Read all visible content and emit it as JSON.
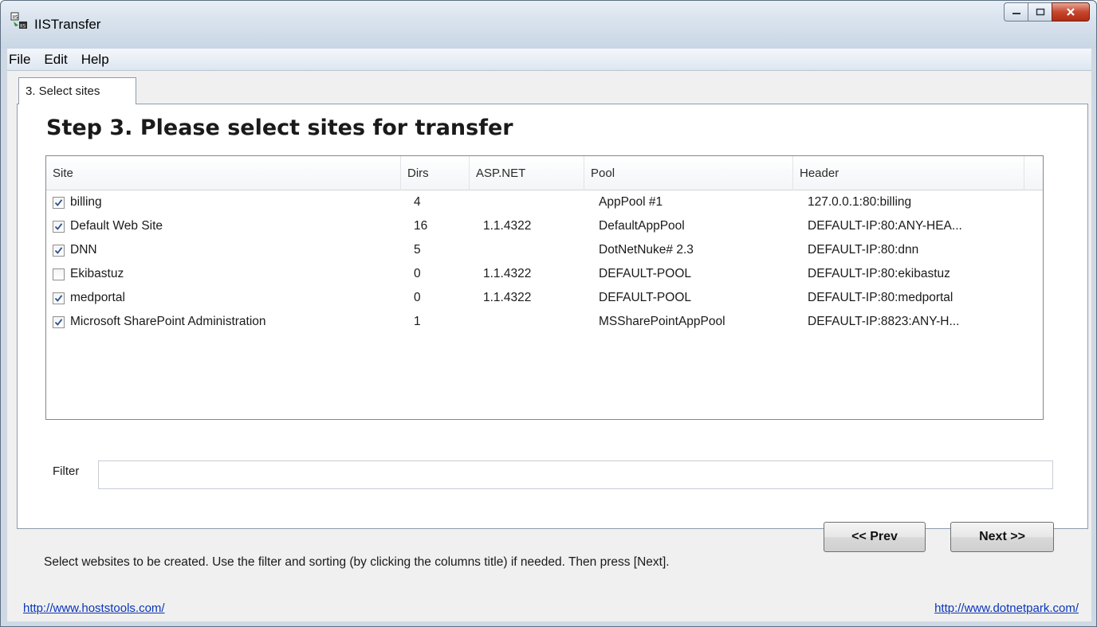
{
  "window": {
    "title": "IISTransfer",
    "icon": "app-icon",
    "controls": {
      "minimize": "minimize-icon",
      "maximize": "maximize-icon",
      "close": "close-icon"
    }
  },
  "menu": {
    "items": [
      "File",
      "Edit",
      "Help"
    ]
  },
  "tab": {
    "label": "3. Select sites"
  },
  "page": {
    "title": "Step 3. Please select sites for transfer"
  },
  "table": {
    "columns": [
      "Site",
      "Dirs",
      "ASP.NET",
      "Pool",
      "Header"
    ],
    "rows": [
      {
        "checked": true,
        "site": "billing",
        "dirs": "4",
        "aspnet": "",
        "pool": "AppPool #1",
        "header": "127.0.0.1:80:billing"
      },
      {
        "checked": true,
        "site": "Default Web Site",
        "dirs": "16",
        "aspnet": "1.1.4322",
        "pool": "DefaultAppPool",
        "header": "DEFAULT-IP:80:ANY-HEA..."
      },
      {
        "checked": true,
        "site": "DNN",
        "dirs": "5",
        "aspnet": "",
        "pool": "DotNetNuke# 2.3",
        "header": "DEFAULT-IP:80:dnn"
      },
      {
        "checked": false,
        "site": "Ekibastuz",
        "dirs": "0",
        "aspnet": "1.1.4322",
        "pool": "DEFAULT-POOL",
        "header": "DEFAULT-IP:80:ekibastuz"
      },
      {
        "checked": true,
        "site": "medportal",
        "dirs": "0",
        "aspnet": "1.1.4322",
        "pool": "DEFAULT-POOL",
        "header": "DEFAULT-IP:80:medportal"
      },
      {
        "checked": true,
        "site": "Microsoft SharePoint Administration",
        "dirs": "1",
        "aspnet": "",
        "pool": "MSSharePointAppPool",
        "header": "DEFAULT-IP:8823:ANY-H..."
      }
    ]
  },
  "filter": {
    "label": "Filter",
    "value": ""
  },
  "buttons": {
    "prev": "<< Prev",
    "next": "Next >>"
  },
  "footer": {
    "hint": "Select websites to be created. Use the filter and sorting (by clicking the columns title) if needed. Then press [Next].",
    "link_left": "http://www.hoststools.com/",
    "link_right": "http://www.dotnetpark.com/"
  }
}
